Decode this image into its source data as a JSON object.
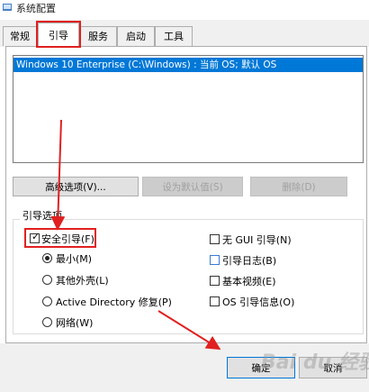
{
  "window": {
    "title": "系统配置"
  },
  "tabs": [
    {
      "label": "常规"
    },
    {
      "label": "引导"
    },
    {
      "label": "服务"
    },
    {
      "label": "启动"
    },
    {
      "label": "工具"
    }
  ],
  "os_list": {
    "entry": "Windows 10 Enterprise (C:\\Windows) : 当前 OS; 默认 OS"
  },
  "buttons": {
    "advanced": "高级选项(V)...",
    "set_default": "设为默认值(S)",
    "delete": "删除(D)",
    "ok": "确定",
    "cancel": "取消"
  },
  "boot_options": {
    "group_label": "引导选项",
    "safe_boot": {
      "label": "安全引导(F)",
      "checked": true
    },
    "radios": [
      {
        "label": "最小(M)",
        "selected": true
      },
      {
        "label": "其他外壳(L)",
        "selected": false
      },
      {
        "label": "Active Directory 修复(P)",
        "selected": false
      },
      {
        "label": "网络(W)",
        "selected": false
      }
    ],
    "right_checks": [
      {
        "label": "无 GUI 引导(N)",
        "checked": false
      },
      {
        "label": "引导日志(B)",
        "checked": false
      },
      {
        "label": "基本视频(E)",
        "checked": false
      },
      {
        "label": "OS 引导信息(O)",
        "checked": false
      }
    ]
  },
  "watermark": "Bai du 经验",
  "colors": {
    "annotation_red": "#e02020",
    "selection_blue": "#0078d7"
  }
}
